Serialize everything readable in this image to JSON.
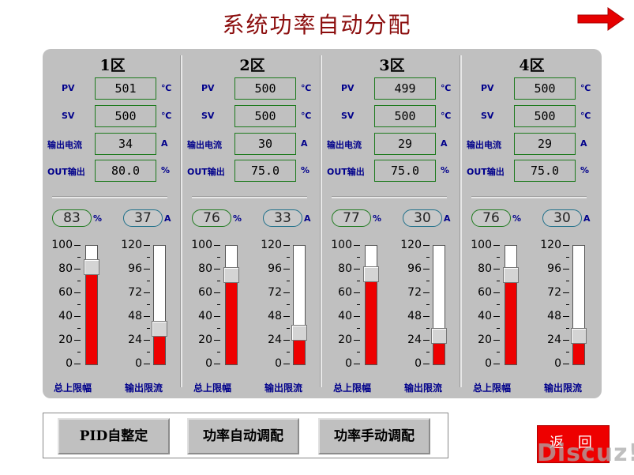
{
  "header": {
    "title": "系统功率自动分配"
  },
  "labels": {
    "pv": "PV",
    "sv": "SV",
    "current": "输出电流",
    "out": "OUT输出",
    "unit_temp": "℃",
    "unit_amp": "A",
    "unit_pct": "%",
    "foot_left": "总上限幅",
    "foot_right": "输出限流"
  },
  "scales": {
    "left": [
      "100",
      "80",
      "60",
      "40",
      "20",
      "0"
    ],
    "right": [
      "120",
      "96",
      "72",
      "48",
      "24",
      "0"
    ]
  },
  "zones": [
    {
      "name": "1区",
      "pv": "501",
      "sv": "500",
      "current": "34",
      "out": "80.0",
      "limit_pct": "83",
      "limit_amp": "37"
    },
    {
      "name": "2区",
      "pv": "500",
      "sv": "500",
      "current": "30",
      "out": "75.0",
      "limit_pct": "76",
      "limit_amp": "33"
    },
    {
      "name": "3区",
      "pv": "499",
      "sv": "500",
      "current": "29",
      "out": "75.0",
      "limit_pct": "77",
      "limit_amp": "30"
    },
    {
      "name": "4区",
      "pv": "500",
      "sv": "500",
      "current": "29",
      "out": "75.0",
      "limit_pct": "76",
      "limit_amp": "30"
    }
  ],
  "buttons": {
    "pid": "PID自整定",
    "auto": "功率自动调配",
    "manual": "功率手动调配",
    "back": "返 回"
  },
  "watermark": "Discuz!",
  "colors": {
    "accent": "#ee0000",
    "panel": "#c0c0c0",
    "title": "#8b0d0d",
    "label": "#00008b"
  }
}
